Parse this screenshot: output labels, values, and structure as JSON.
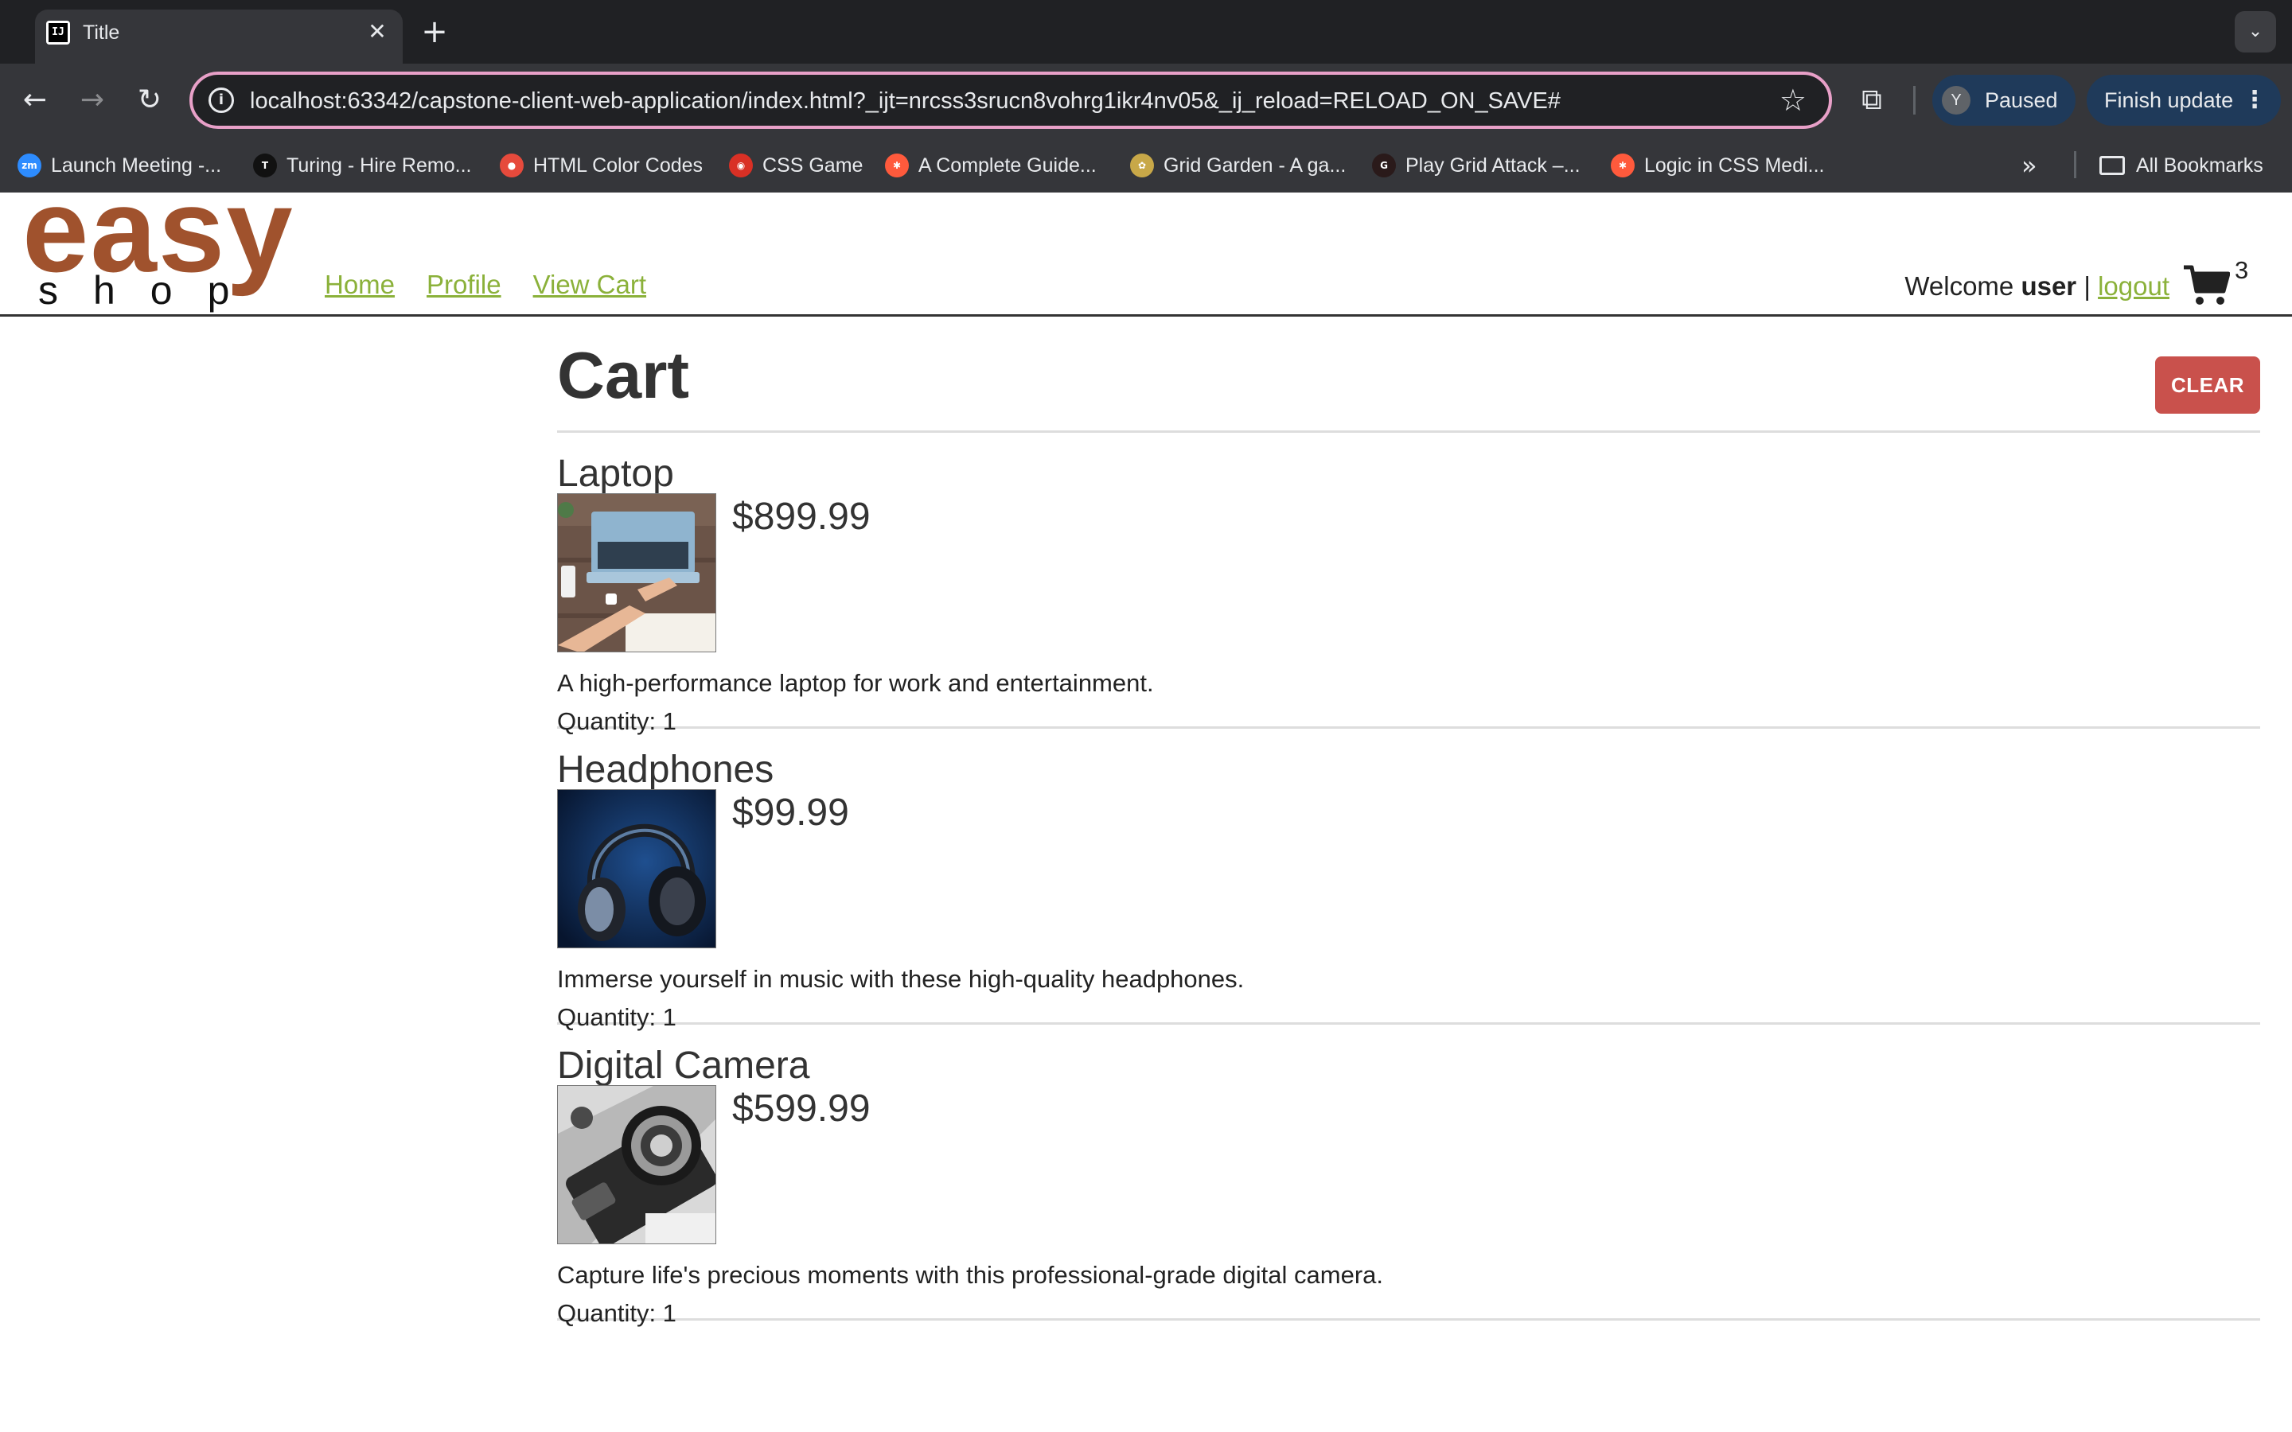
{
  "browser": {
    "tab_title": "Title",
    "tab_favicon_text": "IJ",
    "url": "localhost:63342/capstone-client-web-application/index.html?_ijt=nrcss3srucn8vohrg1ikr4nv05&_ij_reload=RELOAD_ON_SAVE#",
    "profile_initial": "Y",
    "profile_status": "Paused",
    "update_label": "Finish update",
    "bookmarks": [
      {
        "label": "Launch Meeting -...",
        "icon": "zoom-icon",
        "icon_text": "zm",
        "color": "#2d8cff"
      },
      {
        "label": "Turing - Hire Remo...",
        "icon": "turing-icon",
        "icon_text": "T",
        "color": "#111111"
      },
      {
        "label": "HTML Color Codes",
        "icon": "html-color-codes-icon",
        "icon_text": "●",
        "color": "#e64a3c"
      },
      {
        "label": "CSS Game",
        "icon": "css-game-icon",
        "icon_text": "◉",
        "color": "#d93025"
      },
      {
        "label": "A Complete Guide...",
        "icon": "css-tricks-icon",
        "icon_text": "✱",
        "color": "#ff5a3c"
      },
      {
        "label": "Grid Garden - A ga...",
        "icon": "grid-garden-icon",
        "icon_text": "✿",
        "color": "#c8a848"
      },
      {
        "label": "Play Grid Attack –...",
        "icon": "grid-attack-icon",
        "icon_text": "G",
        "color": "#2a1a1a"
      },
      {
        "label": "Logic in CSS Medi...",
        "icon": "css-tricks-icon",
        "icon_text": "✱",
        "color": "#ff5a3c"
      }
    ],
    "all_bookmarks_label": "All Bookmarks"
  },
  "site": {
    "logo_top": "easy",
    "logo_bottom": "shop",
    "logo_color": "#a0522d",
    "link_color": "#8bb13a",
    "nav": [
      {
        "label": "Home"
      },
      {
        "label": "Profile"
      },
      {
        "label": "View Cart"
      }
    ],
    "welcome_prefix": "Welcome",
    "username": "user",
    "separator": "|",
    "logout_label": "logout",
    "cart_count": "3"
  },
  "cart": {
    "title": "Cart",
    "clear_label": "CLEAR",
    "clear_color": "#c9514c",
    "quantity_prefix": "Quantity:",
    "items": [
      {
        "name": "Laptop",
        "price": "$899.99",
        "description": "A high-performance laptop for work and entertainment.",
        "quantity_label": "Quantity: 1",
        "image": "laptop-photo"
      },
      {
        "name": "Headphones",
        "price": "$99.99",
        "description": "Immerse yourself in music with these high-quality headphones.",
        "quantity_label": "Quantity: 1",
        "image": "headphones-photo"
      },
      {
        "name": "Digital Camera",
        "price": "$599.99",
        "description": "Capture life's precious moments with this professional-grade digital camera.",
        "quantity_label": "Quantity: 1",
        "image": "camera-photo"
      }
    ]
  }
}
